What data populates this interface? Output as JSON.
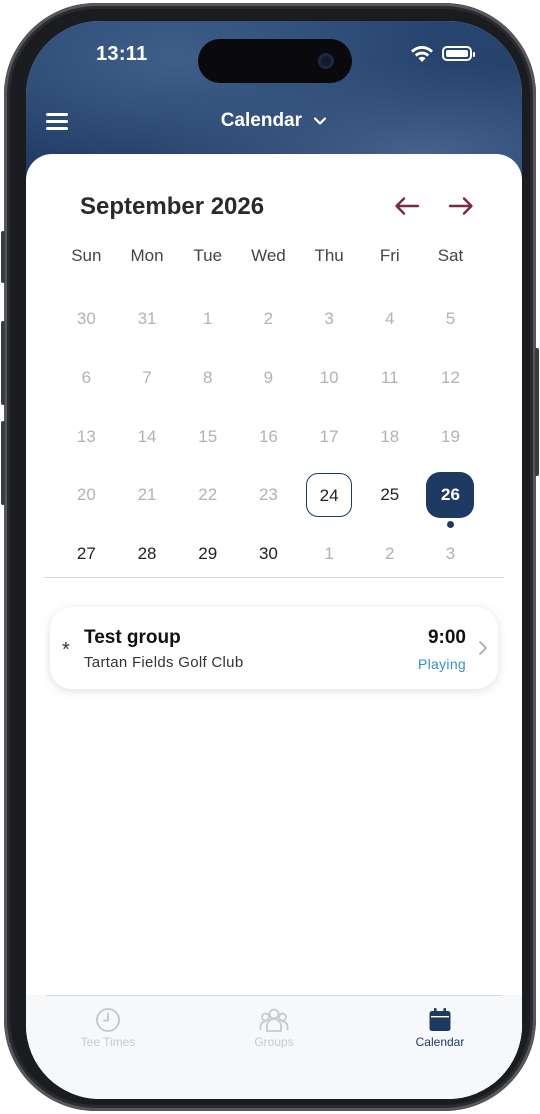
{
  "status_bar": {
    "time": "13:11"
  },
  "header": {
    "title": "Calendar"
  },
  "calendar": {
    "month_label": "September 2026",
    "weekdays": [
      "Sun",
      "Mon",
      "Tue",
      "Wed",
      "Thu",
      "Fri",
      "Sat"
    ],
    "weeks": [
      [
        "30",
        "31",
        "1",
        "2",
        "3",
        "4",
        "5"
      ],
      [
        "6",
        "7",
        "8",
        "9",
        "10",
        "11",
        "12"
      ],
      [
        "13",
        "14",
        "15",
        "16",
        "17",
        "18",
        "19"
      ],
      [
        "20",
        "21",
        "22",
        "23",
        "24",
        "25",
        "26"
      ],
      [
        "27",
        "28",
        "29",
        "30",
        "1",
        "2",
        "3"
      ]
    ],
    "today": "24",
    "selected": "26"
  },
  "event": {
    "marker": "*",
    "group_name": "Test group",
    "club_name": "Tartan Fields Golf Club",
    "time": "9:00",
    "status": "Playing"
  },
  "tabs": [
    {
      "label": "Tee Times",
      "icon": "clock-icon"
    },
    {
      "label": "Groups",
      "icon": "groups-icon"
    },
    {
      "label": "Calendar",
      "icon": "calendar-icon"
    }
  ],
  "colors": {
    "primary": "#1e3a63",
    "accent_arrow": "#7a2a3f",
    "status_blue": "#2e8fd6"
  }
}
